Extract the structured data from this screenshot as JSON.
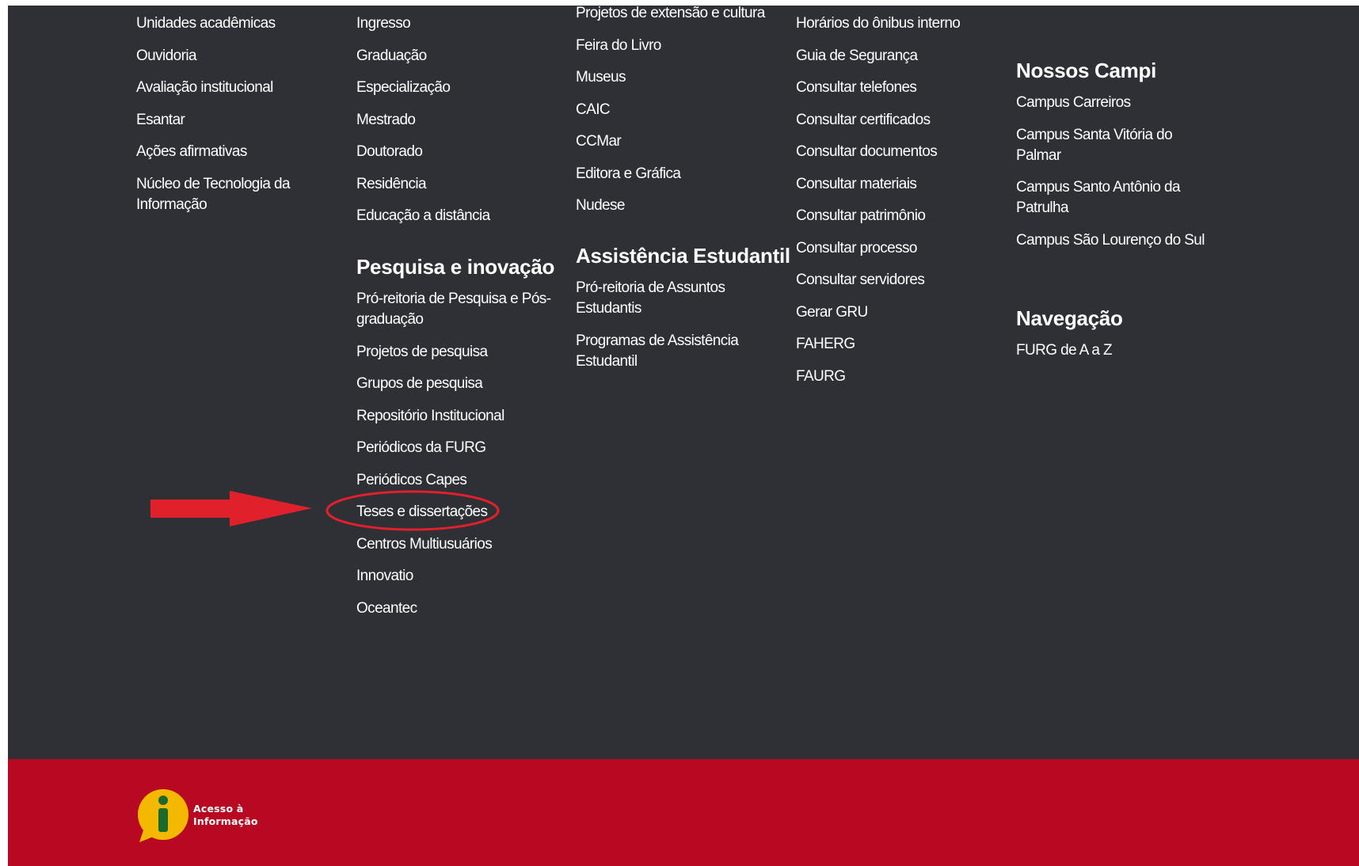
{
  "col1": {
    "links": [
      "Unidades acadêmicas",
      "Ouvidoria",
      "Avaliação institucional",
      "Esantar",
      "Ações afirmativas",
      "Núcleo de Tecnologia da Informação"
    ]
  },
  "col2": {
    "links": [
      "Ingresso",
      "Graduação",
      "Especialização",
      "Mestrado",
      "Doutorado",
      "Residência",
      "Educação a distância"
    ],
    "research": {
      "title": "Pesquisa e inovação",
      "links": [
        "Pró-reitoria de Pesquisa e Pós-graduação",
        "Projetos de pesquisa",
        "Grupos de pesquisa",
        "Repositório Institucional",
        "Periódicos da FURG",
        "Periódicos Capes",
        "Teses e dissertações",
        "Centros Multiusuários",
        "Innovatio",
        "Oceantec"
      ]
    }
  },
  "col3": {
    "links": [
      "Projetos de extensão e cultura",
      "Feira do Livro",
      "Museus",
      "CAIC",
      "CCMar",
      "Editora e Gráfica",
      "Nudese"
    ],
    "assistance": {
      "title": "Assistência Estudantil",
      "links": [
        "Pró-reitoria de Assuntos Estudantis",
        "Programas de Assistência Estudantil"
      ]
    }
  },
  "col4": {
    "links": [
      "Horários do ônibus interno",
      "Guia de Segurança",
      "Consultar telefones",
      "Consultar certificados",
      "Consultar documentos",
      "Consultar materiais",
      "Consultar patrimônio",
      "Consultar processo",
      "Consultar servidores",
      "Gerar GRU",
      "FAHERG",
      "FAURG"
    ]
  },
  "col5": {
    "campi": {
      "title": "Nossos Campi",
      "links": [
        "Campus Carreiros",
        "Campus Santa Vitória do Palmar",
        "Campus Santo Antônio da Patrulha",
        "Campus São Lourenço do Sul"
      ]
    },
    "navigation": {
      "title": "Navegação",
      "links": [
        "FURG de A a Z"
      ]
    }
  },
  "footer": {
    "logo_text_line1": "Acesso à",
    "logo_text_line2": "Informação",
    "logo_icon": "info-icon",
    "bar_color": "#b70a22",
    "logo_color": "#f5b800"
  },
  "colors": {
    "background": "#2f3036",
    "text": "#ffffff",
    "annotation": "#e0202a"
  }
}
